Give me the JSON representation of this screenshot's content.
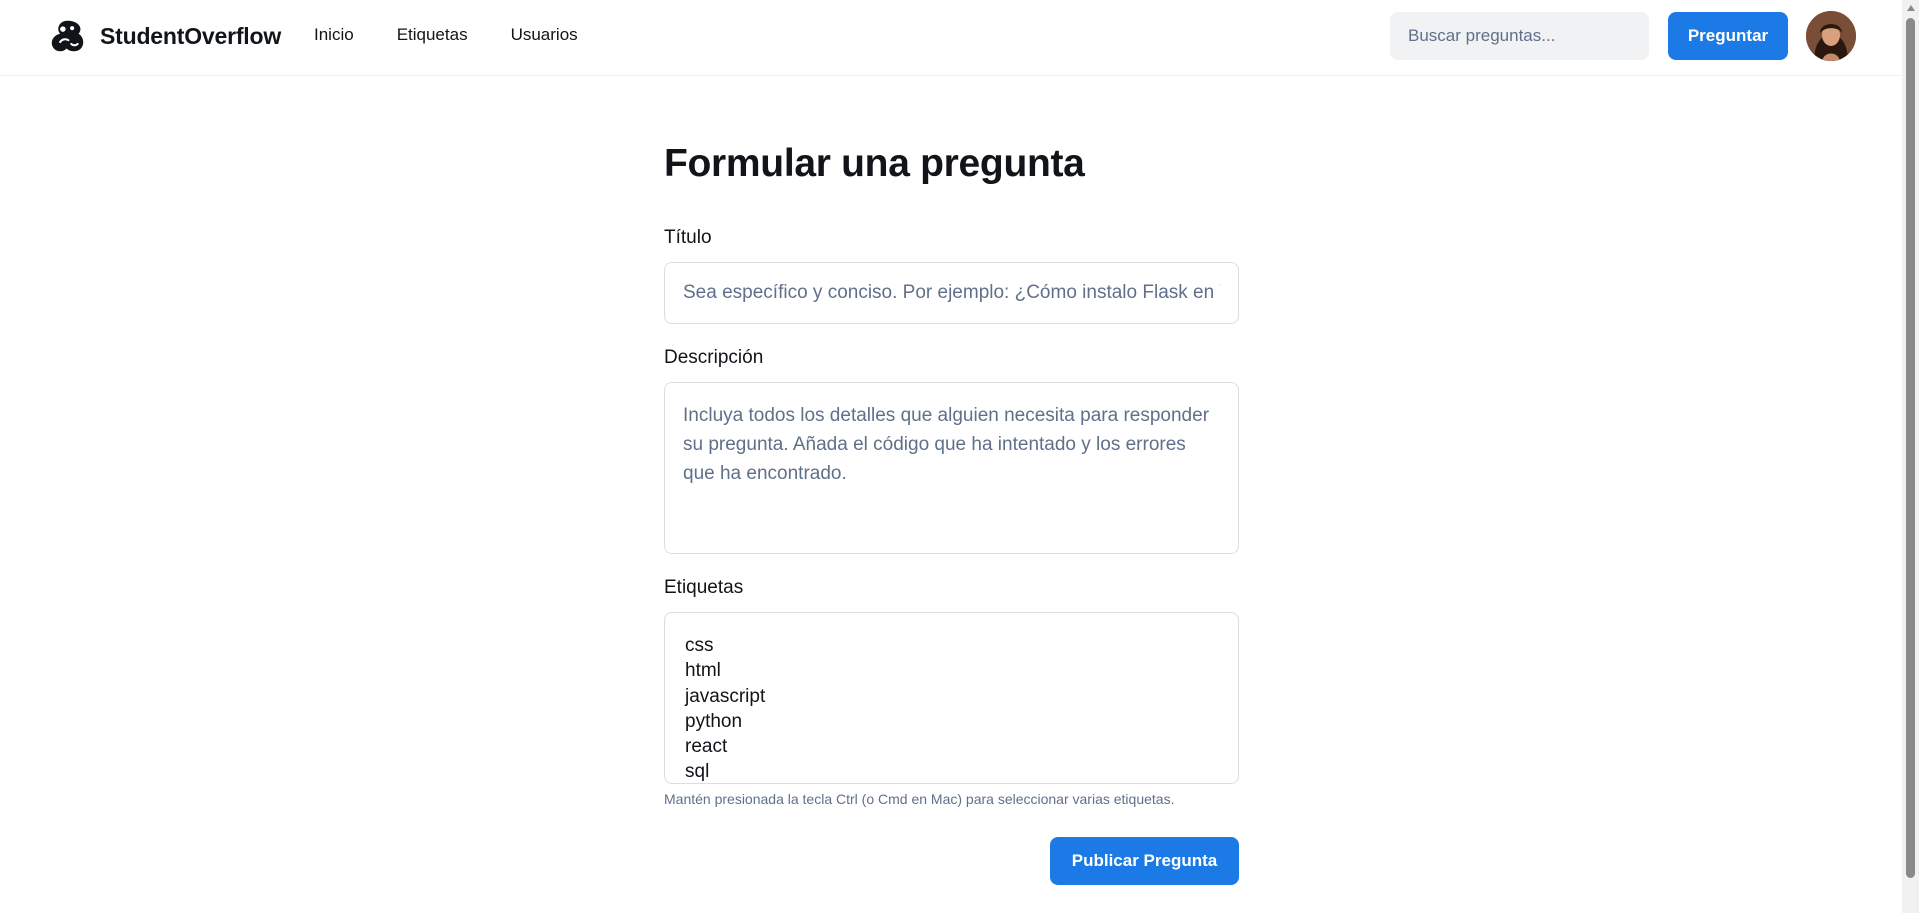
{
  "header": {
    "brand_name": "StudentOverflow",
    "logo_icon": "student-logo-icon",
    "nav": {
      "home": "Inicio",
      "tags": "Etiquetas",
      "users": "Usuarios"
    },
    "search_placeholder": "Buscar preguntas...",
    "ask_label": "Preguntar",
    "avatar_icon": "user-avatar"
  },
  "form": {
    "title": "Formular una pregunta",
    "title_label": "Título",
    "title_placeholder": "Sea específico y conciso. Por ejemplo: ¿Cómo instalo Flask en Windows?",
    "description_label": "Descripción",
    "description_placeholder": "Incluya todos los detalles que alguien necesita para responder su pregunta. Añada el código que ha intentado y los errores que ha encontrado.",
    "tags_label": "Etiquetas",
    "tags_options": [
      "css",
      "html",
      "javascript",
      "python",
      "react",
      "sql"
    ],
    "tags_help": "Mantén presionada la tecla Ctrl (o Cmd en Mac) para seleccionar varias etiquetas.",
    "submit_label": "Publicar Pregunta"
  },
  "colors": {
    "primary": "#1c7ae6",
    "text": "#111418",
    "muted": "#60708a",
    "border": "#d9dee5"
  }
}
